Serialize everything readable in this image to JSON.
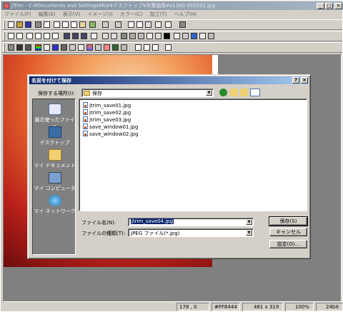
{
  "window": {
    "title": "JTrim - C:¥Documents and Settings¥Rie¥デスクトップ¥作業画像¥a1380 001032.jpg"
  },
  "menu": [
    "ファイル(F)",
    "編集(E)",
    "表示(V)",
    "イメージ(I)",
    "カラー(C)",
    "加工(T)",
    "ヘルプ(H)"
  ],
  "dialog": {
    "title": "名前を付けて保存",
    "save_in_label": "保存する場所(I):",
    "save_in_value": "保存",
    "places": [
      "最近使ったファイル",
      "デスクトップ",
      "マイ ドキュメント",
      "マイ コンピュータ",
      "マイ ネットワーク"
    ],
    "files": [
      "jtrim_save01.jpg",
      "jtrim_save02.jpg",
      "jtrim_save03.jpg",
      "save_window01.jpg",
      "save_window02.jpg"
    ],
    "filename_label": "ファイル名(N):",
    "filename_value": "jtrim_save04.jpg",
    "filetype_label": "ファイルの種類(T):",
    "filetype_value": "JPEG ファイル(*.jpg)",
    "save_button": "保存(S)",
    "cancel_button": "キャンセル",
    "settings_button": "設定(O)..."
  },
  "status": {
    "coords": "178 , 0",
    "color": "#FF8444",
    "size": "481 x 319",
    "zoom": "100%",
    "depth": "24bit"
  }
}
